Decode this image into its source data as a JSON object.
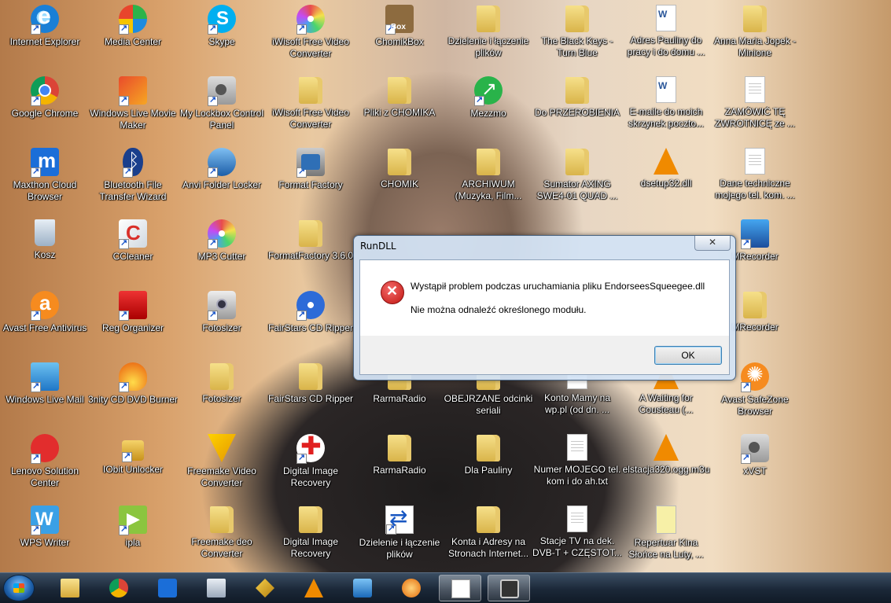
{
  "desktop": {
    "icons": [
      {
        "label": "Internet Explorer",
        "icon": "internet-explorer-icon"
      },
      {
        "label": "Media Center",
        "icon": "media-center-icon"
      },
      {
        "label": "Skype",
        "icon": "skype-icon"
      },
      {
        "label": "iWisoft Free Video Converter",
        "icon": "iwisoft-icon"
      },
      {
        "label": "ChomikBox",
        "icon": "chomikbox-icon"
      },
      {
        "label": "Dzielenie i łączenie plików",
        "icon": "folder-icon"
      },
      {
        "label": "The Black Keys - Turn Blue",
        "icon": "folder-icon"
      },
      {
        "label": "Adres Pauliny do pracy i do domu ...",
        "icon": "word-document-icon"
      },
      {
        "label": "Anna Maria Jopek - Minione",
        "icon": "folder-icon"
      },
      {
        "label": "Google Chrome",
        "icon": "chrome-icon"
      },
      {
        "label": "Windows Live Movie Maker",
        "icon": "movie-maker-icon"
      },
      {
        "label": "My Lockbox Control Panel",
        "icon": "lockbox-icon"
      },
      {
        "label": "iWisoft Free Video Converter",
        "icon": "folder-icon"
      },
      {
        "label": "Pliki z CHOMIKA",
        "icon": "folder-icon"
      },
      {
        "label": "Mezzmo",
        "icon": "mezzmo-icon"
      },
      {
        "label": "Do PRZEROBIENIA",
        "icon": "folder-icon"
      },
      {
        "label": "E-maile do moich skrzynek poczto...",
        "icon": "word-document-icon"
      },
      {
        "label": "ZAMÓWIĆ TĘ ZWROTNICĘ ze ...",
        "icon": "text-document-icon"
      },
      {
        "label": "Maxthon Cloud Browser",
        "icon": "maxthon-icon"
      },
      {
        "label": "Bluetooth File Transfer Wizard",
        "icon": "bluetooth-icon"
      },
      {
        "label": "Anvi Folder Locker",
        "icon": "anvi-icon"
      },
      {
        "label": "Format Factory",
        "icon": "format-factory-icon"
      },
      {
        "label": "CHOMIK",
        "icon": "folder-icon"
      },
      {
        "label": "ARCHIWUM (Muzyka, Film...",
        "icon": "folder-icon"
      },
      {
        "label": "Sumator AXING SWE4-01 QUAD ...",
        "icon": "folder-icon"
      },
      {
        "label": "dsetup32.dll",
        "icon": "vlc-icon"
      },
      {
        "label": "Dane techniczne mojego tel. kom. ...",
        "icon": "text-document-icon"
      },
      {
        "label": "Kosz",
        "icon": "recycle-bin-icon"
      },
      {
        "label": "CCleaner",
        "icon": "ccleaner-icon"
      },
      {
        "label": "MP3 Cutter",
        "icon": "mp3-cutter-icon"
      },
      {
        "label": "FormatFactory 3.6.0",
        "icon": "folder-icon"
      },
      {
        "label": "MRecorder",
        "icon": "mrecorder-icon"
      },
      {
        "label": "Avast Free Antivirus",
        "icon": "avast-icon"
      },
      {
        "label": "Reg Organizer",
        "icon": "reg-organizer-icon"
      },
      {
        "label": "Fotosizer",
        "icon": "fotosizer-icon"
      },
      {
        "label": "FairStars CD Ripper",
        "icon": "cd-ripper-icon"
      },
      {
        "label": "MRecorder",
        "icon": "folder-icon"
      },
      {
        "label": "Windows Live Mail",
        "icon": "live-mail-icon"
      },
      {
        "label": "3nity CD DVD Burner",
        "icon": "burner-icon"
      },
      {
        "label": "Fotosizer",
        "icon": "folder-icon"
      },
      {
        "label": "FairStars CD Ripper",
        "icon": "folder-icon"
      },
      {
        "label": "RarmaRadio",
        "icon": "folder-icon"
      },
      {
        "label": "OBEJRZANE odcinki seriali",
        "icon": "folder-icon"
      },
      {
        "label": "Konto Mamy na wp.pl (od dn. ...",
        "icon": "text-document-icon"
      },
      {
        "label": "A Waiting for Cousteau (...",
        "icon": "vlc-icon"
      },
      {
        "label": "Avast SafeZone Browser",
        "icon": "avast-safezone-icon"
      },
      {
        "label": "Lenovo Solution Center",
        "icon": "lenovo-icon"
      },
      {
        "label": "IObit Unlocker",
        "icon": "unlocker-icon"
      },
      {
        "label": "Freemake Video Converter",
        "icon": "freemake-icon"
      },
      {
        "label": "Digital Image Recovery",
        "icon": "image-recovery-icon"
      },
      {
        "label": "RarmaRadio",
        "icon": "folder-icon"
      },
      {
        "label": "Dla Pauliny",
        "icon": "folder-icon"
      },
      {
        "label": "Numer MOJEGO tel. kom i do ah.txt",
        "icon": "text-document-icon"
      },
      {
        "label": "elstacja320.ogg.m3u",
        "icon": "vlc-icon"
      },
      {
        "label": "xVST",
        "icon": "xvst-icon"
      },
      {
        "label": "WPS Writer",
        "icon": "wps-writer-icon"
      },
      {
        "label": "ipla",
        "icon": "ipla-icon"
      },
      {
        "label": "Freemake deo Converter",
        "icon": "folder-icon"
      },
      {
        "label": "Digital Image Recovery",
        "icon": "folder-icon"
      },
      {
        "label": "Dzielenie i łączenie plików",
        "icon": "file-splitter-icon"
      },
      {
        "label": "Konta i Adresy na Stronach Internet...",
        "icon": "folder-icon"
      },
      {
        "label": "Stacje TV na dek. DVB-T + CZĘSTOT...",
        "icon": "text-document-icon"
      },
      {
        "label": "Repertuar Kina Słońce na Luty, ...",
        "icon": "text-document-icon"
      }
    ]
  },
  "dialog": {
    "title": "RunDLL",
    "close_label": "✕",
    "message_line1": "Wystąpił problem podczas uruchamiania pliku EndorseesSqueegee.dll",
    "message_line2": "Nie można odnaleźć określonego modułu.",
    "ok_label": "OK"
  },
  "taskbar": {
    "items": [
      {
        "icon": "file-explorer-icon"
      },
      {
        "icon": "chrome-icon"
      },
      {
        "icon": "maxthon-icon"
      },
      {
        "icon": "calculator-icon"
      },
      {
        "icon": "winamp-icon"
      },
      {
        "icon": "vlc-icon"
      },
      {
        "icon": "media-player-icon"
      },
      {
        "icon": "rarma-radio-icon"
      },
      {
        "icon": "notepad-icon"
      },
      {
        "icon": "camera-icon"
      }
    ]
  }
}
